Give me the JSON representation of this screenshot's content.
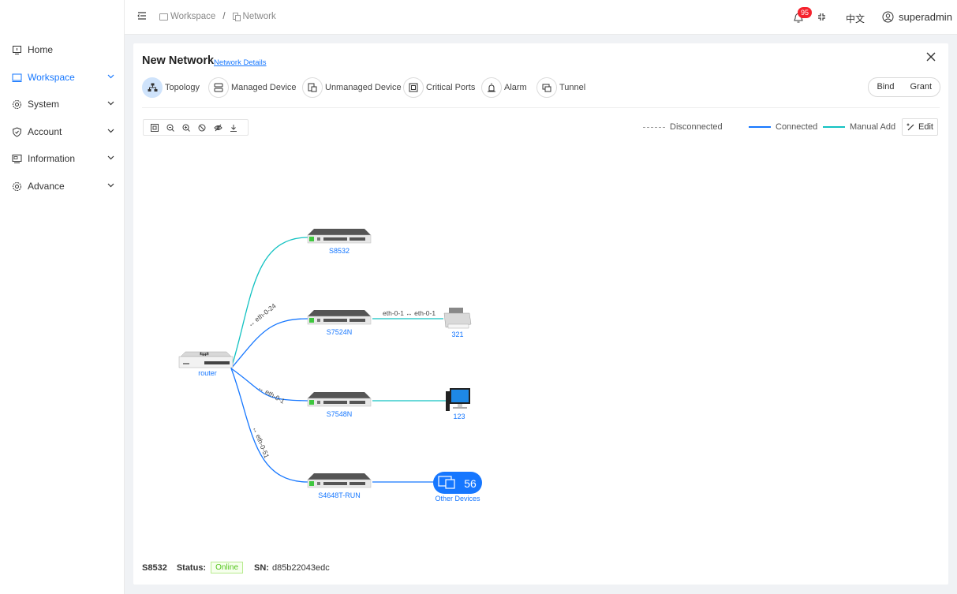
{
  "sidebar": {
    "items": [
      {
        "label": "Home",
        "icon": "home-icon"
      },
      {
        "label": "Workspace",
        "icon": "workspace-icon"
      },
      {
        "label": "System",
        "icon": "gear-icon"
      },
      {
        "label": "Account",
        "icon": "shield-icon"
      },
      {
        "label": "Information",
        "icon": "monitor-icon"
      },
      {
        "label": "Advance",
        "icon": "gear-icon"
      }
    ]
  },
  "header": {
    "breadcrumb": [
      "Workspace",
      "Network"
    ],
    "breadcrumb_separator": "/",
    "notification_count": "95",
    "language": "中文",
    "username": "superadmin"
  },
  "page": {
    "title": "New Network",
    "details_link": "Network Details",
    "tabs": [
      "Topology",
      "Managed Device",
      "Unmanaged Device",
      "Critical Ports",
      "Alarm",
      "Tunnel"
    ],
    "active_tab": "Topology",
    "actions": [
      "Bind",
      "Grant"
    ]
  },
  "legend": {
    "disconnected": "Disconnected",
    "connected": "Connected",
    "manual_add": "Manual Add",
    "edit": "Edit"
  },
  "topology": {
    "devices": {
      "router": "router",
      "s8532": "S8532",
      "s7524n": "S7524N",
      "s7548n": "S7548N",
      "s4648t": "S4648T-RUN",
      "printer": "321",
      "pc": "123",
      "other_count": "56",
      "other_label": "Other Devices"
    },
    "links": {
      "router_s7524n": "↔ eth-0-24",
      "router_s7548n": "↔ eth-0-1",
      "router_s4648t": "↔ eth-0-51",
      "s7524n_printer": "eth-0-1 ↔ eth-0-1"
    }
  },
  "status": {
    "device": "S8532",
    "status_label": "Status:",
    "status_value": "Online",
    "sn_label": "SN:",
    "sn_value": "d85b22043edc"
  },
  "colors": {
    "accent": "#1677ff",
    "connected": "#1677ff",
    "manual_add": "#13c2c2",
    "badge": "#f5222d",
    "online": "#52c41a"
  }
}
